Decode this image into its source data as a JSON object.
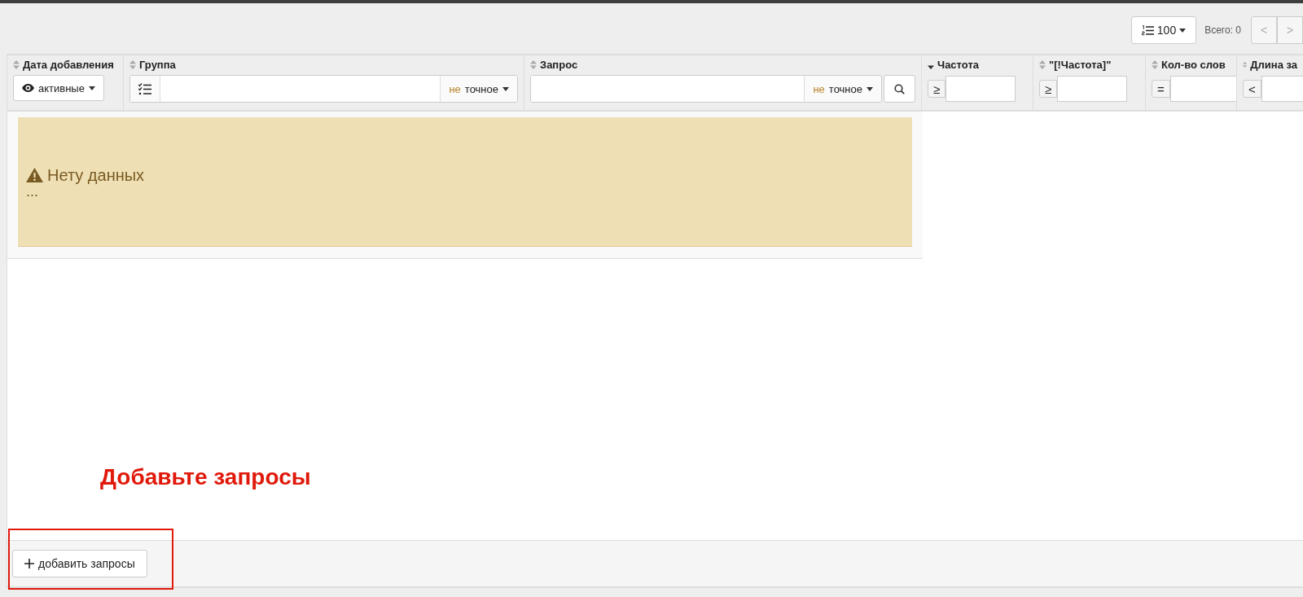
{
  "toolbar": {
    "page_size": "100",
    "total": "Всего: 0",
    "pager": [
      {
        "label": "<",
        "disabled": true
      },
      {
        "label": ">",
        "disabled": true
      }
    ]
  },
  "table": {
    "columns": [
      {
        "label": "Дата добавления",
        "sorted": false,
        "filter": {
          "kind": "dropdown",
          "value": "активные"
        }
      },
      {
        "label": "Группа",
        "sorted": false,
        "filter": {
          "kind": "text-match",
          "negation": "не",
          "mode": "точное"
        }
      },
      {
        "label": "Запрос",
        "sorted": false,
        "filter": {
          "kind": "text-search",
          "negation": "не",
          "mode": "точное"
        }
      },
      {
        "label": "Частота",
        "sorted": true,
        "filter": {
          "kind": "compare",
          "operator": "≥"
        }
      },
      {
        "label": "\"[!Частота]\"",
        "sorted": false,
        "filter": {
          "kind": "compare",
          "operator": "≥"
        }
      },
      {
        "label": "Кол-во слов",
        "sorted": false,
        "filter": {
          "kind": "compare",
          "operator": "="
        }
      },
      {
        "label": "Длина за",
        "sorted": false,
        "filter": {
          "kind": "compare",
          "operator": "<"
        }
      }
    ],
    "empty_message": {
      "title": "Нету данных",
      "detail": "..."
    }
  },
  "annotation": {
    "text": "Добавьте запросы"
  },
  "footer": {
    "add_button": "добавить запросы"
  }
}
